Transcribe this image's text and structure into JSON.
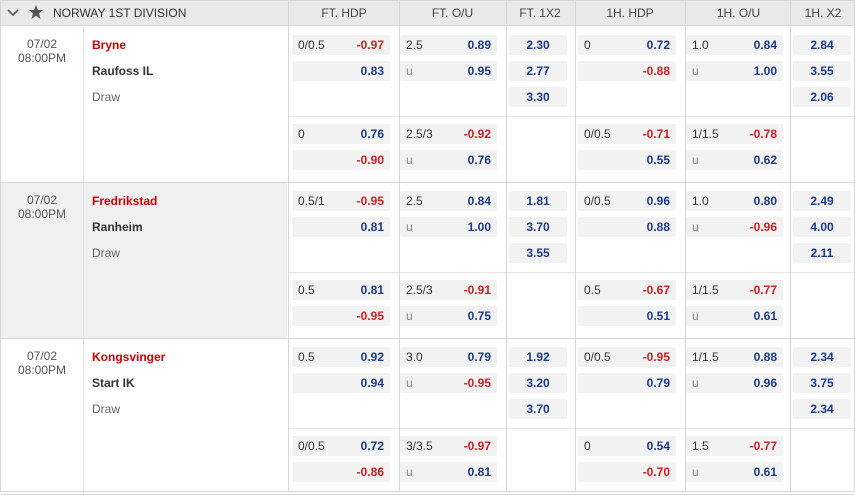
{
  "header": {
    "league": "NORWAY 1ST DIVISION",
    "cols": [
      "FT. HDP",
      "FT. O/U",
      "FT. 1X2",
      "1H. HDP",
      "1H. O/U",
      "1H. X2"
    ]
  },
  "matches": [
    {
      "date": "07/02",
      "time": "08:00PM",
      "home": "Bryne",
      "away": "Raufoss IL",
      "draw": "Draw",
      "x12": [
        "2.30",
        "2.77",
        "3.30"
      ],
      "h1x2": [
        "2.84",
        "3.55",
        "2.06"
      ],
      "lines": [
        {
          "fthdp": {
            "line": "0/0.5",
            "top": "-0.97",
            "bottom": "0.83"
          },
          "ftou": {
            "line": "2.5",
            "top": "0.89",
            "u": "u",
            "bottom": "0.95"
          },
          "hhdp": {
            "line": "0",
            "top": "0.72",
            "bottom": "-0.88"
          },
          "hou": {
            "line": "1.0",
            "top": "0.84",
            "u": "u",
            "bottom": "1.00"
          }
        },
        {
          "fthdp": {
            "line": "0",
            "top": "0.76",
            "bottom": "-0.90"
          },
          "ftou": {
            "line": "2.5/3",
            "top": "-0.92",
            "u": "u",
            "bottom": "0.76"
          },
          "hhdp": {
            "line": "0/0.5",
            "top": "-0.71",
            "bottom": "0.55"
          },
          "hou": {
            "line": "1/1.5",
            "top": "-0.78",
            "u": "u",
            "bottom": "0.62"
          }
        }
      ]
    },
    {
      "date": "07/02",
      "time": "08:00PM",
      "home": "Fredrikstad",
      "away": "Ranheim",
      "draw": "Draw",
      "x12": [
        "1.81",
        "3.70",
        "3.55"
      ],
      "h1x2": [
        "2.49",
        "4.00",
        "2.11"
      ],
      "lines": [
        {
          "fthdp": {
            "line": "0.5/1",
            "top": "-0.95",
            "bottom": "0.81"
          },
          "ftou": {
            "line": "2.5",
            "top": "0.84",
            "u": "u",
            "bottom": "1.00"
          },
          "hhdp": {
            "line": "0/0.5",
            "top": "0.96",
            "bottom": "0.88"
          },
          "hou": {
            "line": "1.0",
            "top": "0.80",
            "u": "u",
            "bottom": "-0.96"
          }
        },
        {
          "fthdp": {
            "line": "0.5",
            "top": "0.81",
            "bottom": "-0.95"
          },
          "ftou": {
            "line": "2.5/3",
            "top": "-0.91",
            "u": "u",
            "bottom": "0.75"
          },
          "hhdp": {
            "line": "0.5",
            "top": "-0.67",
            "bottom": "0.51"
          },
          "hou": {
            "line": "1/1.5",
            "top": "-0.77",
            "u": "u",
            "bottom": "0.61"
          }
        }
      ]
    },
    {
      "date": "07/02",
      "time": "08:00PM",
      "home": "Kongsvinger",
      "away": "Start IK",
      "draw": "Draw",
      "x12": [
        "1.92",
        "3.20",
        "3.70"
      ],
      "h1x2": [
        "2.34",
        "3.75",
        "2.34"
      ],
      "lines": [
        {
          "fthdp": {
            "line": "0.5",
            "top": "0.92",
            "bottom": "0.94"
          },
          "ftou": {
            "line": "3.0",
            "top": "0.79",
            "u": "u",
            "bottom": "-0.95"
          },
          "hhdp": {
            "line": "0/0.5",
            "top": "-0.95",
            "bottom": "0.79"
          },
          "hou": {
            "line": "1/1.5",
            "top": "0.88",
            "u": "u",
            "bottom": "0.96"
          }
        },
        {
          "fthdp": {
            "line": "0/0.5",
            "top": "0.72",
            "bottom": "-0.86"
          },
          "ftou": {
            "line": "3/3.5",
            "top": "-0.97",
            "u": "u",
            "bottom": "0.81"
          },
          "hhdp": {
            "line": "0",
            "top": "0.54",
            "bottom": "-0.70"
          },
          "hou": {
            "line": "1.5",
            "top": "-0.77",
            "u": "u",
            "bottom": "0.61"
          }
        }
      ]
    }
  ]
}
